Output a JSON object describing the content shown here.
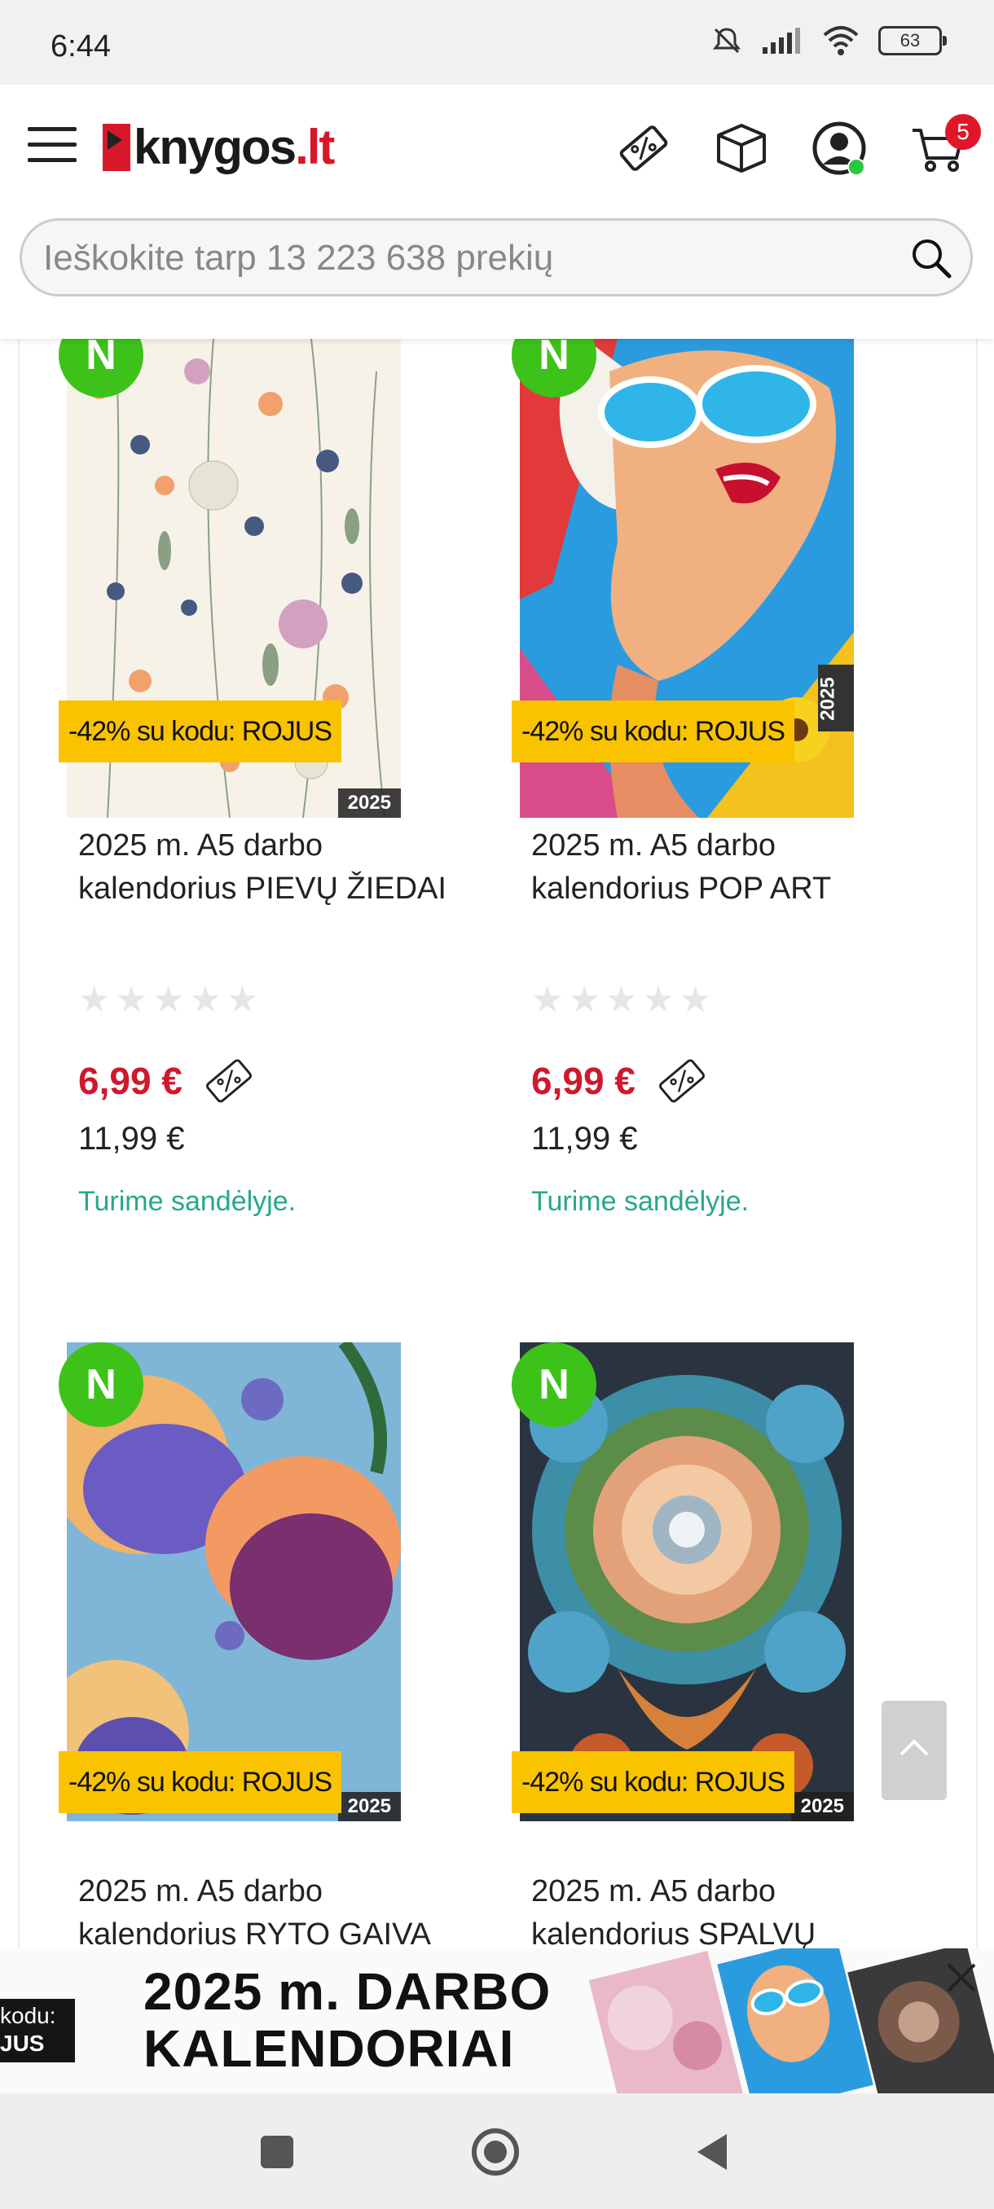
{
  "status_bar": {
    "time": "6:44",
    "battery": "63"
  },
  "header": {
    "logo_text": "knygos",
    "logo_suffix": ".lt",
    "cart_count": "5",
    "search_placeholder": "Ieškokite tarp 13 223 638 prekių",
    "icons": [
      "menu-icon",
      "discount-tag-icon",
      "box-icon",
      "user-icon",
      "cart-icon",
      "search-icon"
    ]
  },
  "products": [
    {
      "badge": "N",
      "promo": "-42% su kodu: ROJUS",
      "cover_year": "2025",
      "title": "2025 m. A5 darbo kalendorius PIEVŲ ŽIEDAI",
      "rating": 0,
      "price": "6,99 €",
      "old_price": "11,99 €",
      "stock": "Turime sandėlyje."
    },
    {
      "badge": "N",
      "promo": "-42% su kodu: ROJUS",
      "cover_year": "2025",
      "title": "2025 m. A5 darbo kalendorius POP ART",
      "rating": 0,
      "price": "6,99 €",
      "old_price": "11,99 €",
      "stock": "Turime sandėlyje."
    },
    {
      "badge": "N",
      "promo": "-42% su kodu: ROJUS",
      "cover_year": "2025",
      "title": "2025 m. A5 darbo kalendorius RYTO GAIVA"
    },
    {
      "badge": "N",
      "promo": "-42% su kodu: ROJUS",
      "cover_year": "2025",
      "title": "2025 m. A5 darbo kalendorius SPALVŲ"
    }
  ],
  "banner": {
    "code_line1": "kodu:",
    "code_line2": "JUS",
    "title_line1": "2025 m. DARBO",
    "title_line2": "KALENDORIAI"
  },
  "colors": {
    "brand_red": "#d8182a",
    "price_red": "#d0182c",
    "new_badge_green": "#3dc21a",
    "promo_yellow": "#f9c300",
    "stock_green": "#26a889"
  }
}
